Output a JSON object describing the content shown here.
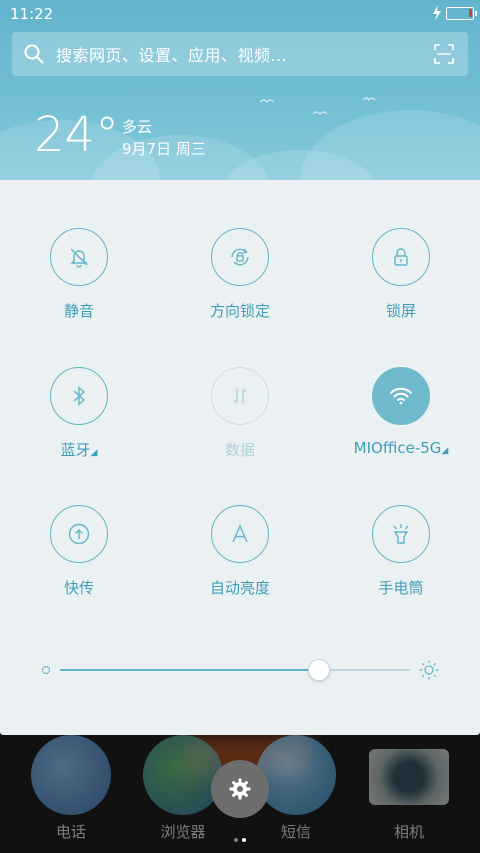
{
  "status_bar": {
    "time": "11:22"
  },
  "search": {
    "placeholder": "搜索网页、设置、应用、视频..."
  },
  "weather": {
    "temperature": "24°",
    "condition": "多云",
    "date": "9月7日 周三"
  },
  "toggles": [
    {
      "label": "静音",
      "icon": "bell-off-icon",
      "state": "off"
    },
    {
      "label": "方向锁定",
      "icon": "rotation-lock-icon",
      "state": "off"
    },
    {
      "label": "锁屏",
      "icon": "lock-icon",
      "state": "off"
    },
    {
      "label": "蓝牙",
      "icon": "bluetooth-icon",
      "state": "off",
      "has_menu": true
    },
    {
      "label": "数据",
      "icon": "data-arrows-icon",
      "state": "disabled"
    },
    {
      "label": "MIOffice-5G",
      "icon": "wifi-icon",
      "state": "on",
      "has_menu": true
    },
    {
      "label": "快传",
      "icon": "upload-icon",
      "state": "off"
    },
    {
      "label": "自动亮度",
      "icon": "auto-brightness-icon",
      "state": "off"
    },
    {
      "label": "手电筒",
      "icon": "flashlight-icon",
      "state": "off"
    }
  ],
  "brightness": {
    "level": 0.74
  },
  "dock": {
    "apps": [
      {
        "label": "电话",
        "icon": "phone-icon"
      },
      {
        "label": "浏览器",
        "icon": "browser-icon"
      },
      {
        "label": "短信",
        "icon": "messages-icon"
      },
      {
        "label": "相机",
        "icon": "camera-icon"
      }
    ],
    "settings_icon": "gear-icon"
  },
  "colors": {
    "accent": "#63b5c9",
    "panel_bg": "#ebf1f3",
    "header_bg": "#6cbbd1"
  }
}
